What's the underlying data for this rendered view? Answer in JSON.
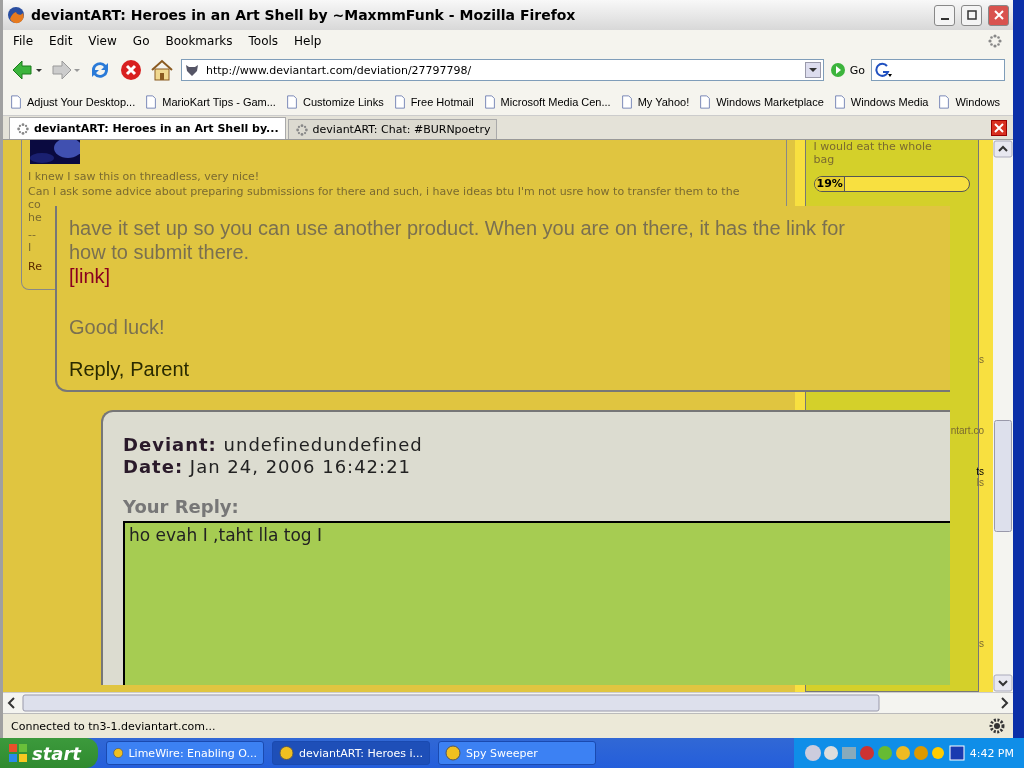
{
  "window": {
    "title": "deviantART: Heroes in an Art Shell by ~MaxmmFunk - Mozilla Firefox"
  },
  "menu": [
    "File",
    "Edit",
    "View",
    "Go",
    "Bookmarks",
    "Tools",
    "Help"
  ],
  "toolbar": {
    "url": "http://www.deviantart.com/deviation/27797798/",
    "go": "Go"
  },
  "bookmarks": [
    "Adjust Your Desktop...",
    "MarioKart Tips - Gam...",
    "Customize Links",
    "Free Hotmail",
    "Microsoft Media Cen...",
    "My Yahoo!",
    "Windows Marketplace",
    "Windows Media",
    "Windows"
  ],
  "tabs": [
    {
      "label": "deviantART: Heroes in an Art Shell by...",
      "selected": true
    },
    {
      "label": "deviantART: Chat: #BURNpoetry",
      "selected": false
    }
  ],
  "background_comment": {
    "lines": [
      "I knew I saw this on threadless, very nice!",
      "Can I ask some advice about preparing submissions for there and such, i have ideas btu I'm not usre how to transfer them to the"
    ],
    "fragments": [
      "co",
      "he",
      "--",
      "I"
    ],
    "reply_link": "Re"
  },
  "sidebar": {
    "lines": [
      "I would eat the whole",
      "bag"
    ],
    "poll": {
      "reading": "19%",
      "level": 0.19
    },
    "fragments": [
      "s",
      "ntart.co",
      "ts",
      "ls",
      "s"
    ]
  },
  "comment": {
    "lines": [
      "have it set up so you can use another product. When you are on there, it has the link for",
      "how to submit there."
    ],
    "link": "[link]",
    "closing": "Good luck!",
    "actions": [
      "Reply,",
      "Parent"
    ]
  },
  "reply_form": {
    "deviant_label": "Deviant:",
    "deviant": "undefinedundefined",
    "date_label": "Date:",
    "date": "Jan 24, 2006 16:42:21",
    "reply_label": "Your Reply:",
    "value": "ho evah I ,taht lla tog I"
  },
  "status_bar": "Connected to tn3-1.deviantart.com...",
  "taskbar": {
    "start": "start",
    "tasks": [
      {
        "label": "LimeWire: Enabling O...",
        "selected": false
      },
      {
        "label": "deviantART: Heroes i...",
        "selected": true
      },
      {
        "label": "Spy Sweeper",
        "selected": false
      }
    ],
    "clock": "4:42 PM"
  }
}
